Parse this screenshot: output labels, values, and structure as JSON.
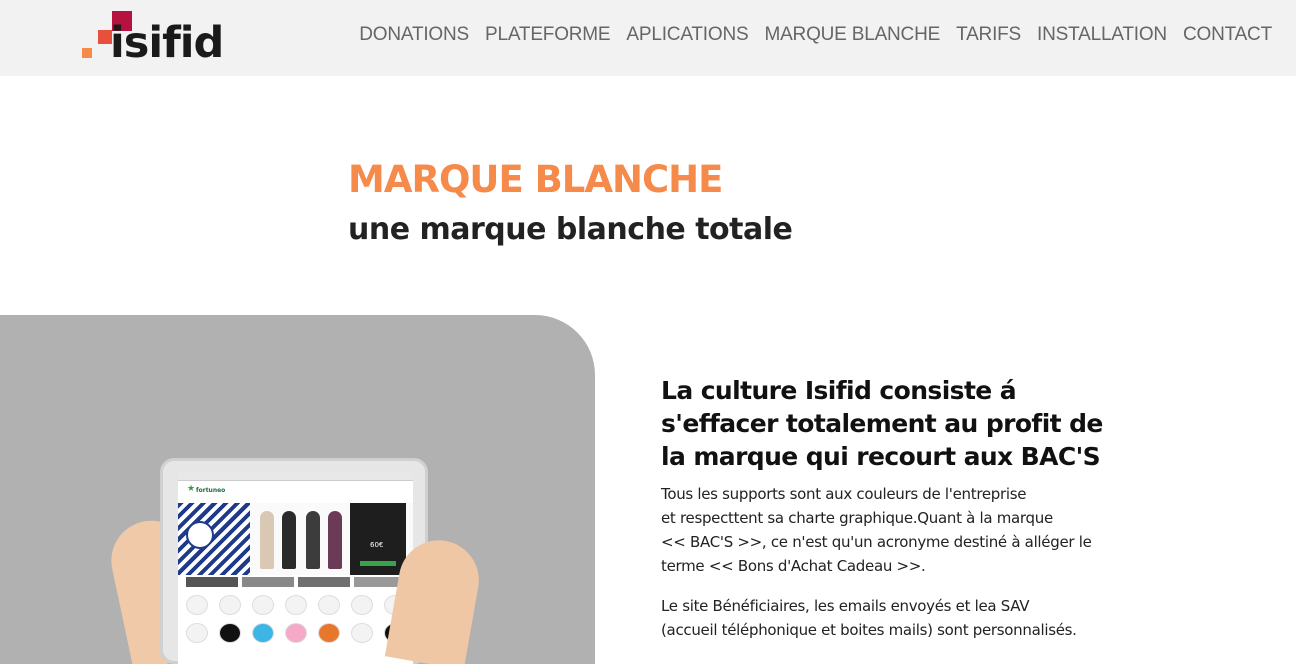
{
  "brand": {
    "logo_text": "isifid"
  },
  "nav": {
    "items": [
      {
        "label": "DONATIONS"
      },
      {
        "label": "PLATEFORME"
      },
      {
        "label": "APLICATIONS"
      },
      {
        "label": "MARQUE BLANCHE"
      },
      {
        "label": "TARIFS"
      },
      {
        "label": "INSTALLATION"
      },
      {
        "label": "CONTACT"
      }
    ]
  },
  "hero": {
    "title": "MARQUE BLANCHE",
    "subtitle": "une marque blanche totale"
  },
  "tablet": {
    "site_name": "fortuneo",
    "promo_value": "60€"
  },
  "content": {
    "heading": "La culture Isifid consiste á s'effacer totalement au profit de la marque qui recourt aux BAC'S",
    "paragraph1_lines": [
      "Tous les supports sont aux couleurs de l'entreprise",
      "et respecttent sa charte graphique.Quant à la marque",
      "<< BAC'S >>, ce n'est qu'un acronyme destiné à alléger le",
      "terme << Bons d'Achat Cadeau >>."
    ],
    "paragraph2_lines": [
      "Le site Bénéficiaires, les emails envoyés et lea SAV",
      "(accueil téléphonique et boites mails) sont personnalisés."
    ]
  },
  "colors": {
    "accent": "#f58a4b",
    "header_bg": "#f2f2f2",
    "panel_bg": "#b1b1b1",
    "logo_red": "#b5123f"
  }
}
